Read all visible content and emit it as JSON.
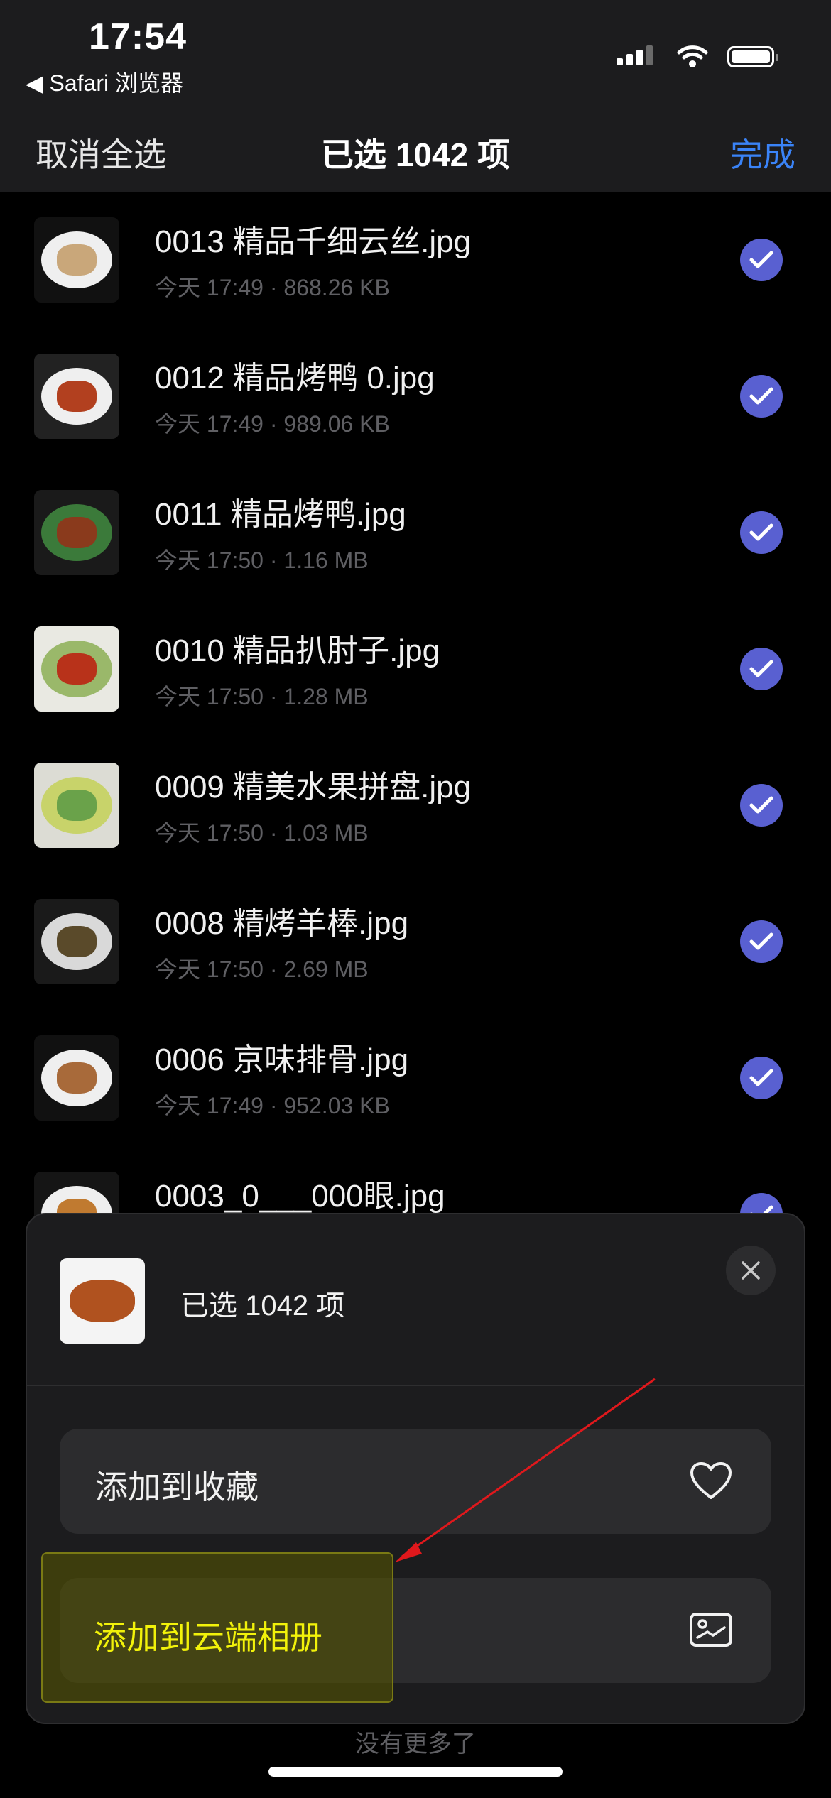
{
  "status_bar": {
    "time": "17:54",
    "back_app": "◀ Safari 浏览器"
  },
  "nav": {
    "left_label": "取消全选",
    "title": "已选 1042 项",
    "right_label": "完成"
  },
  "files": [
    {
      "name": "0013 精品千细云丝.jpg",
      "meta": "今天 17:49 · 868.26 KB"
    },
    {
      "name": "0012 精品烤鸭 0.jpg",
      "meta": "今天 17:49 · 989.06 KB"
    },
    {
      "name": "0011 精品烤鸭.jpg",
      "meta": "今天 17:50 · 1.16 MB"
    },
    {
      "name": "0010 精品扒肘子.jpg",
      "meta": "今天 17:50 · 1.28 MB"
    },
    {
      "name": "0009 精美水果拼盘.jpg",
      "meta": "今天 17:50 · 1.03 MB"
    },
    {
      "name": "0008 精烤羊棒.jpg",
      "meta": "今天 17:50 · 2.69 MB"
    },
    {
      "name": "0006 京味排骨.jpg",
      "meta": "今天 17:49 · 952.03 KB"
    },
    {
      "name": "0003_0___000眼.jpg",
      "meta": ""
    }
  ],
  "sheet": {
    "title": "已选 1042 项",
    "action_favorite": "添加到收藏",
    "action_cloud": "添加到云端相册"
  },
  "footer": {
    "text": "没有更多了"
  },
  "colors": {
    "accent_blue": "#3a83f7",
    "check_purple": "#5960d1",
    "highlight_yellow": "#f2f20a",
    "arrow_red": "#e0181c"
  }
}
